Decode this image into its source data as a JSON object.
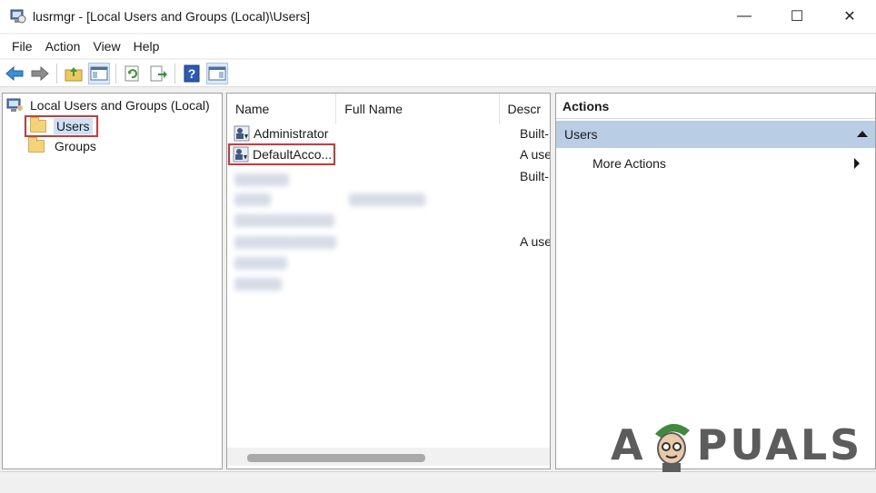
{
  "window": {
    "title": "lusrmgr - [Local Users and Groups (Local)\\Users]",
    "minimize_glyph": "—",
    "maximize_glyph": "☐",
    "close_glyph": "✕"
  },
  "menu": [
    "File",
    "Action",
    "View",
    "Help"
  ],
  "toolbar": {
    "buttons": [
      "back-arrow-icon",
      "forward-arrow-icon",
      "up-folder-icon",
      "show-hide-tree-icon",
      "refresh-icon",
      "export-list-icon",
      "help-icon",
      "action-pane-icon"
    ]
  },
  "tree": {
    "root_label": "Local Users and Groups (Local)",
    "nodes": [
      {
        "label": "Users",
        "selected": true
      },
      {
        "label": "Groups",
        "selected": false
      }
    ]
  },
  "list": {
    "columns": [
      "Name",
      "Full Name",
      "Descr"
    ],
    "rows": [
      {
        "name": "Administrator",
        "full_name": "",
        "description": "Built-"
      },
      {
        "name": "DefaultAcco...",
        "full_name": "",
        "description": "A use"
      },
      {
        "name": "",
        "full_name": "",
        "description": "Built-"
      },
      {
        "name": "",
        "full_name": "",
        "description": ""
      },
      {
        "name": "",
        "full_name": "",
        "description": ""
      },
      {
        "name": "",
        "full_name": "",
        "description": "A use"
      }
    ]
  },
  "actions": {
    "header": "Actions",
    "section": "Users",
    "more_actions": "More Actions"
  },
  "watermark": {
    "text_left": "A",
    "text_right": "PUALS"
  },
  "colors": {
    "highlight_border": "#dd3333",
    "selection_bg": "#cce0f6",
    "actions_section_bg": "#b9cde4"
  }
}
